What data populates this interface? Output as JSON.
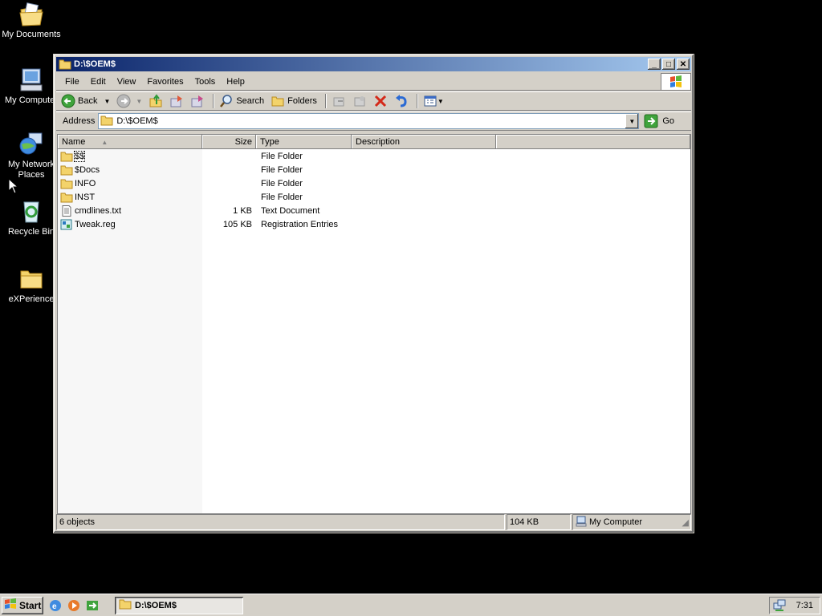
{
  "desktop": {
    "icons": [
      {
        "label": "My Documents"
      },
      {
        "label": "My Computer"
      },
      {
        "label": "My Network Places"
      },
      {
        "label": "Recycle Bin"
      },
      {
        "label": "eXPerience"
      }
    ]
  },
  "window": {
    "title": "D:\\$OEM$",
    "menu": [
      "File",
      "Edit",
      "View",
      "Favorites",
      "Tools",
      "Help"
    ],
    "toolbar": {
      "back_label": "Back",
      "search_label": "Search",
      "folders_label": "Folders"
    },
    "address": {
      "label": "Address",
      "value": "D:\\$OEM$",
      "go_label": "Go"
    },
    "columns": [
      "Name",
      "Size",
      "Type",
      "Description"
    ],
    "files": [
      {
        "name": "$$",
        "size": "",
        "type": "File Folder",
        "icon": "folder-icon"
      },
      {
        "name": "$Docs",
        "size": "",
        "type": "File Folder",
        "icon": "folder-icon"
      },
      {
        "name": "INFO",
        "size": "",
        "type": "File Folder",
        "icon": "folder-icon"
      },
      {
        "name": "INST",
        "size": "",
        "type": "File Folder",
        "icon": "folder-icon"
      },
      {
        "name": "cmdlines.txt",
        "size": "1 KB",
        "type": "Text Document",
        "icon": "text-file-icon"
      },
      {
        "name": "Tweak.reg",
        "size": "105 KB",
        "type": "Registration Entries",
        "icon": "registry-file-icon"
      }
    ],
    "status": {
      "objects": "6 objects",
      "size": "104 KB",
      "location": "My Computer"
    }
  },
  "taskbar": {
    "start_label": "Start",
    "task_label": "D:\\$OEM$",
    "clock": "7:31"
  }
}
